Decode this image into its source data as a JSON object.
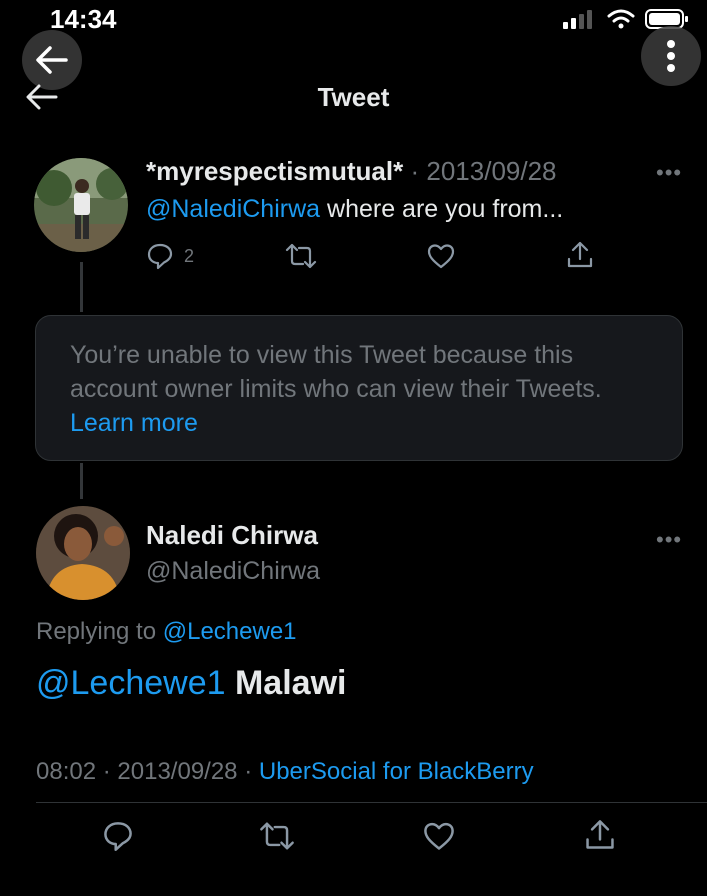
{
  "status_bar": {
    "time": "14:34"
  },
  "header": {
    "title": "Tweet"
  },
  "parent_tweet": {
    "display_name": "*myrespectismutual*",
    "separator": "·",
    "date": "2013/09/28",
    "mention": "@NalediChirwa",
    "text": "where are you from...",
    "reply_count": "2"
  },
  "notice": {
    "text": "You’re unable to view this Tweet because this account owner limits who can view their Tweets.",
    "link": "Learn more"
  },
  "main_tweet": {
    "display_name": "Naledi Chirwa",
    "handle": "@NalediChirwa",
    "replying_prefix": "Replying to",
    "replying_to": "@Lechewe1",
    "mention": "@Lechewe1",
    "text": "Malawi",
    "time": "08:02",
    "separator": "·",
    "date": "2013/09/28",
    "source": "UberSocial for BlackBerry"
  },
  "colors": {
    "background": "#000000",
    "link": "#1d9bf0",
    "muted": "#71767b",
    "text": "#e7e9ea"
  }
}
